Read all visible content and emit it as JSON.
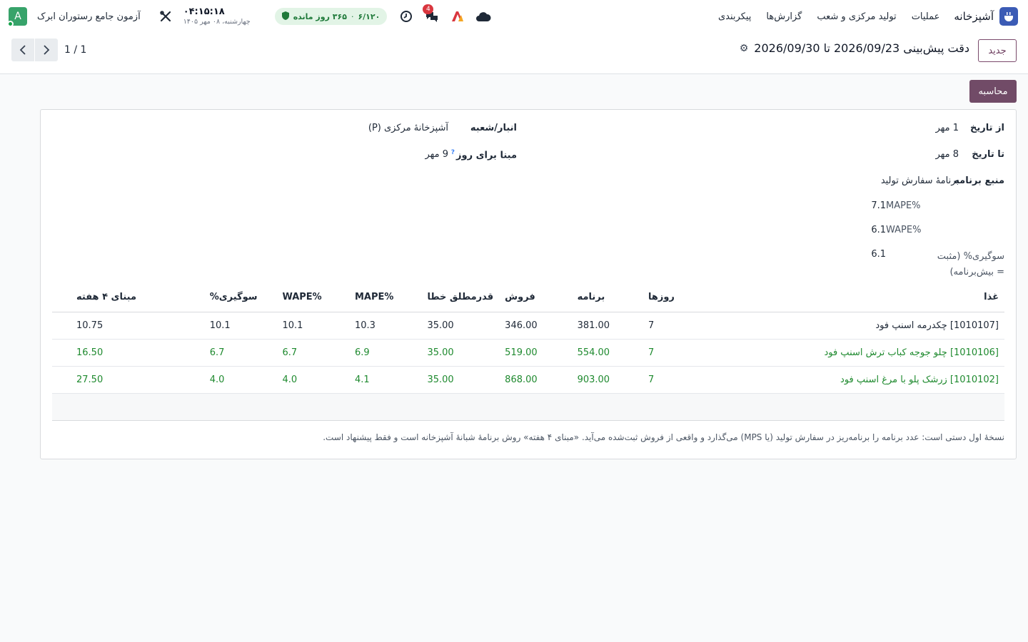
{
  "topbar": {
    "app_name": "آشپزخانه",
    "menu": [
      "عملیات",
      "تولید مرکزی و شعب",
      "گزارش‌ها",
      "پیکربندی"
    ],
    "notification_count": "4",
    "license": {
      "days_left": "۳۶۵ روز مانده",
      "date": "۶/۱۲۰"
    },
    "clock": {
      "time": "۰۴:۱۵:۱۸",
      "date": "چهارشنبه، ۰۸ مهر ۱۴۰۵"
    },
    "company": "آزمون جامع رستوران ابرک",
    "avatar_letter": "A",
    "colors": {
      "accent": "#714b67",
      "brand_logo": "#3b5bb5",
      "avatar": "#37a36a",
      "positive": "#1f8a2f"
    },
    "icons": [
      "cloud-icon",
      "ai-logo-icon",
      "chat-icon",
      "clock-icon",
      "shield-icon",
      "tools-icon"
    ]
  },
  "control": {
    "new_label": "جدید",
    "title": "دقت پیش‌بینی 2026/09/23 تا 2026/09/30",
    "pager": "1 / 1"
  },
  "actions": {
    "compute_label": "محاسبه"
  },
  "form": {
    "from_date": {
      "label": "از تاریخ",
      "value": "1 مهر"
    },
    "to_date": {
      "label": "تا تاریخ",
      "value": "8 مهر"
    },
    "plan_source": {
      "label": "منبع برنامه",
      "value": "برنامهٔ سفارش تولید"
    },
    "mape": {
      "label": "MAPE%",
      "value": "7.1"
    },
    "wape": {
      "label": "WAPE%",
      "value": "6.1"
    },
    "bias": {
      "label": "سوگیری% (مثبت = بیش‌برنامه)",
      "value": "6.1"
    },
    "warehouse": {
      "label": "انبار/شعبه",
      "value": "آشپزخانهٔ مرکزی (P)"
    },
    "base_day": {
      "label": "مبنا برای روز",
      "help": "?",
      "value": "9 مهر"
    }
  },
  "table": {
    "headers": [
      "غذا",
      "روزها",
      "برنامه",
      "فروش",
      "قدرمطلق خطا",
      "MAPE%",
      "WAPE%",
      "سوگیری%",
      "مبنای ۴ هفته"
    ],
    "rows": [
      {
        "food": "[1010107] چکدرمه اسنپ فود",
        "days": "7",
        "plan": "381.00",
        "sales": "346.00",
        "abs_error": "35.00",
        "mape": "10.3",
        "wape": "10.1",
        "bias": "10.1",
        "base4w": "10.75",
        "highlight": false
      },
      {
        "food": "[1010106] چلو جوجه کباب ترش اسنپ فود",
        "days": "7",
        "plan": "554.00",
        "sales": "519.00",
        "abs_error": "35.00",
        "mape": "6.9",
        "wape": "6.7",
        "bias": "6.7",
        "base4w": "16.50",
        "highlight": true
      },
      {
        "food": "[1010102] زرشک پلو با مرغ اسنپ فود",
        "days": "7",
        "plan": "903.00",
        "sales": "868.00",
        "abs_error": "35.00",
        "mape": "4.1",
        "wape": "4.0",
        "bias": "4.0",
        "base4w": "27.50",
        "highlight": true
      }
    ]
  },
  "note": "نسخهٔ اول دستی است: عدد برنامه را برنامه‌ریز در سفارش تولید (یا MPS) می‌گذارد و واقعی از فروش ثبت‌شده می‌آید. «مبنای ۴ هفته» روش برنامهٔ شبانهٔ آشپزخانه است و فقط پیشنهاد است."
}
